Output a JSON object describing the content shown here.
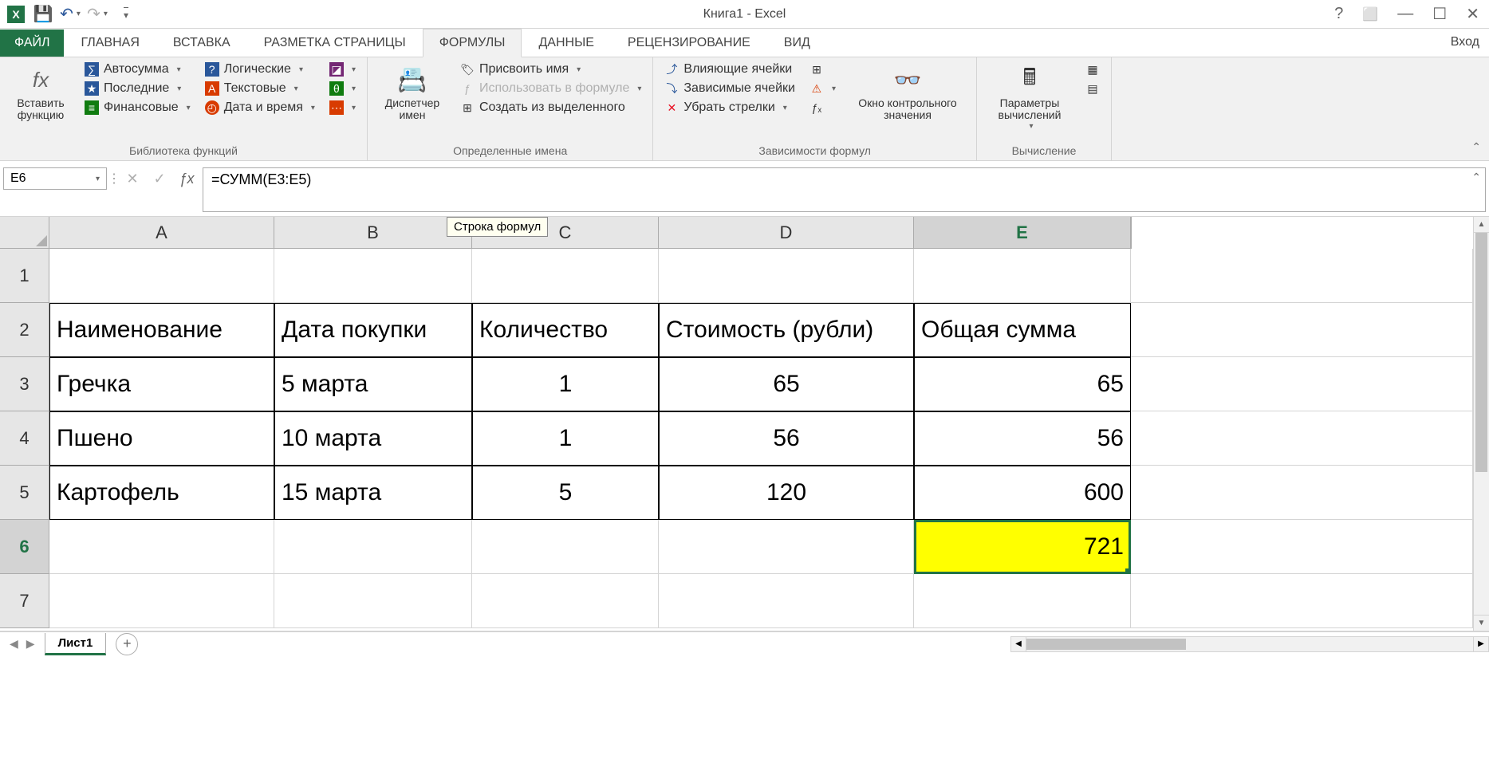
{
  "app": {
    "title": "Книга1 - Excel",
    "signin": "Вход"
  },
  "tabs": {
    "file": "ФАЙЛ",
    "items": [
      "ГЛАВНАЯ",
      "ВСТАВКА",
      "РАЗМЕТКА СТРАНИЦЫ",
      "ФОРМУЛЫ",
      "ДАННЫЕ",
      "РЕЦЕНЗИРОВАНИЕ",
      "ВИД"
    ],
    "active": "ФОРМУЛЫ"
  },
  "ribbon": {
    "g1": {
      "label": "Библиотека функций",
      "insert_fn": "Вставить функцию",
      "autosum": "Автосумма",
      "recent": "Последние",
      "financial": "Финансовые",
      "logical": "Логические",
      "text": "Текстовые",
      "datetime": "Дата и время"
    },
    "g2": {
      "label": "Определенные имена",
      "mgr": "Диспетчер имен",
      "define": "Присвоить имя",
      "use": "Использовать в формуле",
      "create": "Создать из выделенного"
    },
    "g3": {
      "label": "Зависимости формул",
      "prec": "Влияющие ячейки",
      "dep": "Зависимые ячейки",
      "remove": "Убрать стрелки",
      "watch": "Окно контрольного значения"
    },
    "g4": {
      "label": "Вычисление",
      "opts": "Параметры вычислений"
    }
  },
  "fbar": {
    "name": "E6",
    "formula": "=СУММ(E3:E5)",
    "tooltip": "Строка формул"
  },
  "grid": {
    "cols": [
      "A",
      "B",
      "C",
      "D",
      "E"
    ],
    "widths": [
      282,
      248,
      234,
      320,
      272
    ],
    "rows": [
      {
        "n": "1",
        "cells": [
          "",
          "",
          "",
          "",
          ""
        ]
      },
      {
        "n": "2",
        "cells": [
          "Наименование",
          "Дата покупки",
          "Количество",
          "Стоимость (рубли)",
          "Общая сумма"
        ],
        "border": true
      },
      {
        "n": "3",
        "cells": [
          "Гречка",
          "5 марта",
          "1",
          "65",
          "65"
        ],
        "border": true
      },
      {
        "n": "4",
        "cells": [
          "Пшено",
          "10 марта",
          "1",
          "56",
          "56"
        ],
        "border": true
      },
      {
        "n": "5",
        "cells": [
          "Картофель",
          "15 марта",
          "5",
          "120",
          "600"
        ],
        "border": true
      },
      {
        "n": "6",
        "cells": [
          "",
          "",
          "",
          "",
          "721"
        ]
      },
      {
        "n": "7",
        "cells": [
          "",
          "",
          "",
          "",
          ""
        ]
      }
    ],
    "selected": {
      "row": 6,
      "col": 4
    }
  },
  "sheet": {
    "name": "Лист1"
  }
}
